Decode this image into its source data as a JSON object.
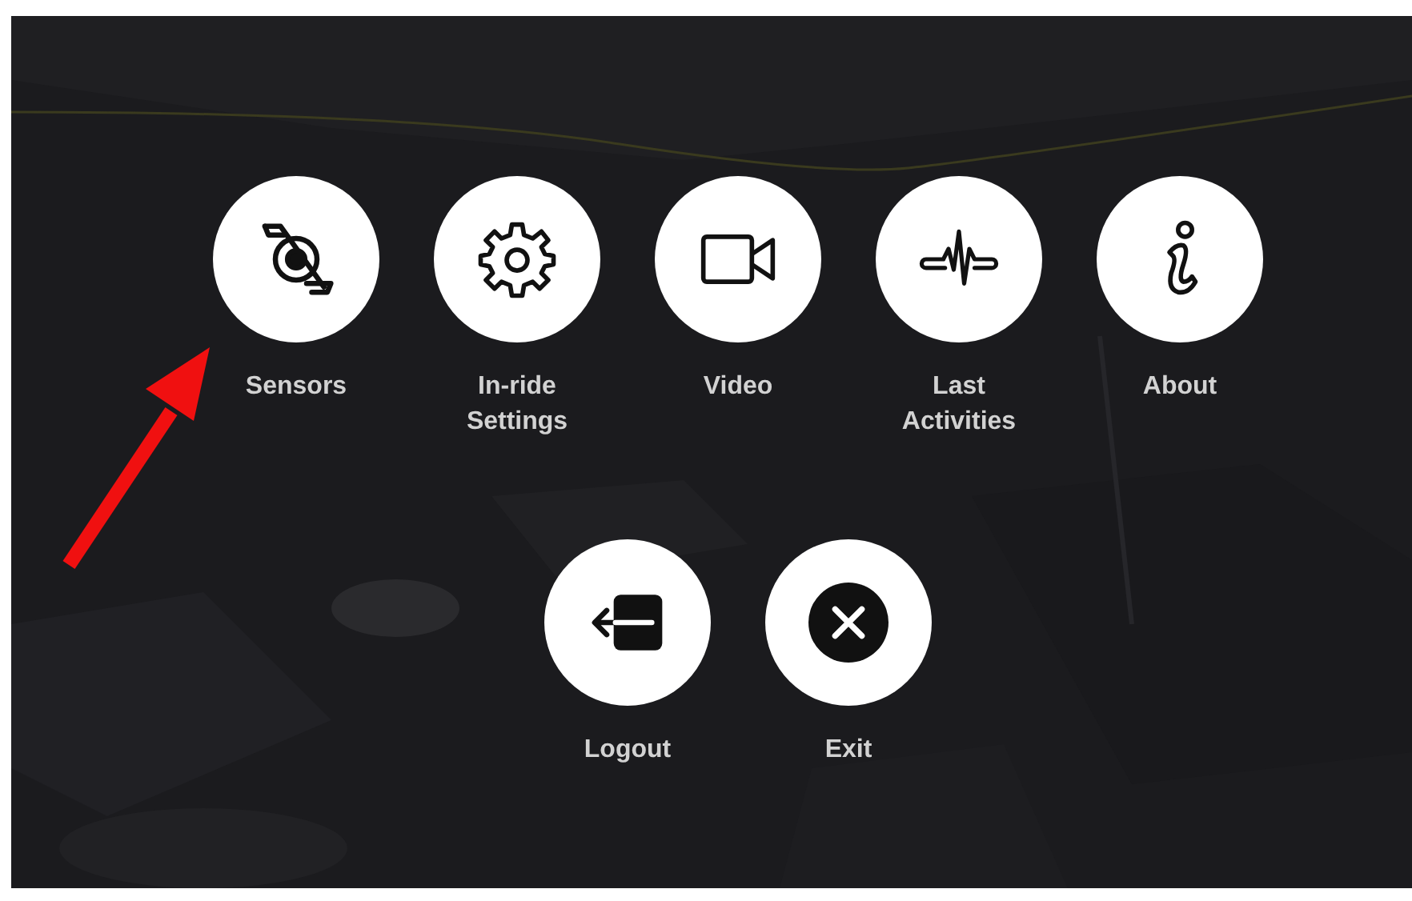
{
  "main_menu": [
    {
      "label": "Sensors"
    },
    {
      "label": "In-ride Settings"
    },
    {
      "label": "Video"
    },
    {
      "label": "Last Activities"
    },
    {
      "label": "About"
    }
  ],
  "bottom_menu": [
    {
      "label": "Logout"
    },
    {
      "label": "Exit"
    }
  ]
}
